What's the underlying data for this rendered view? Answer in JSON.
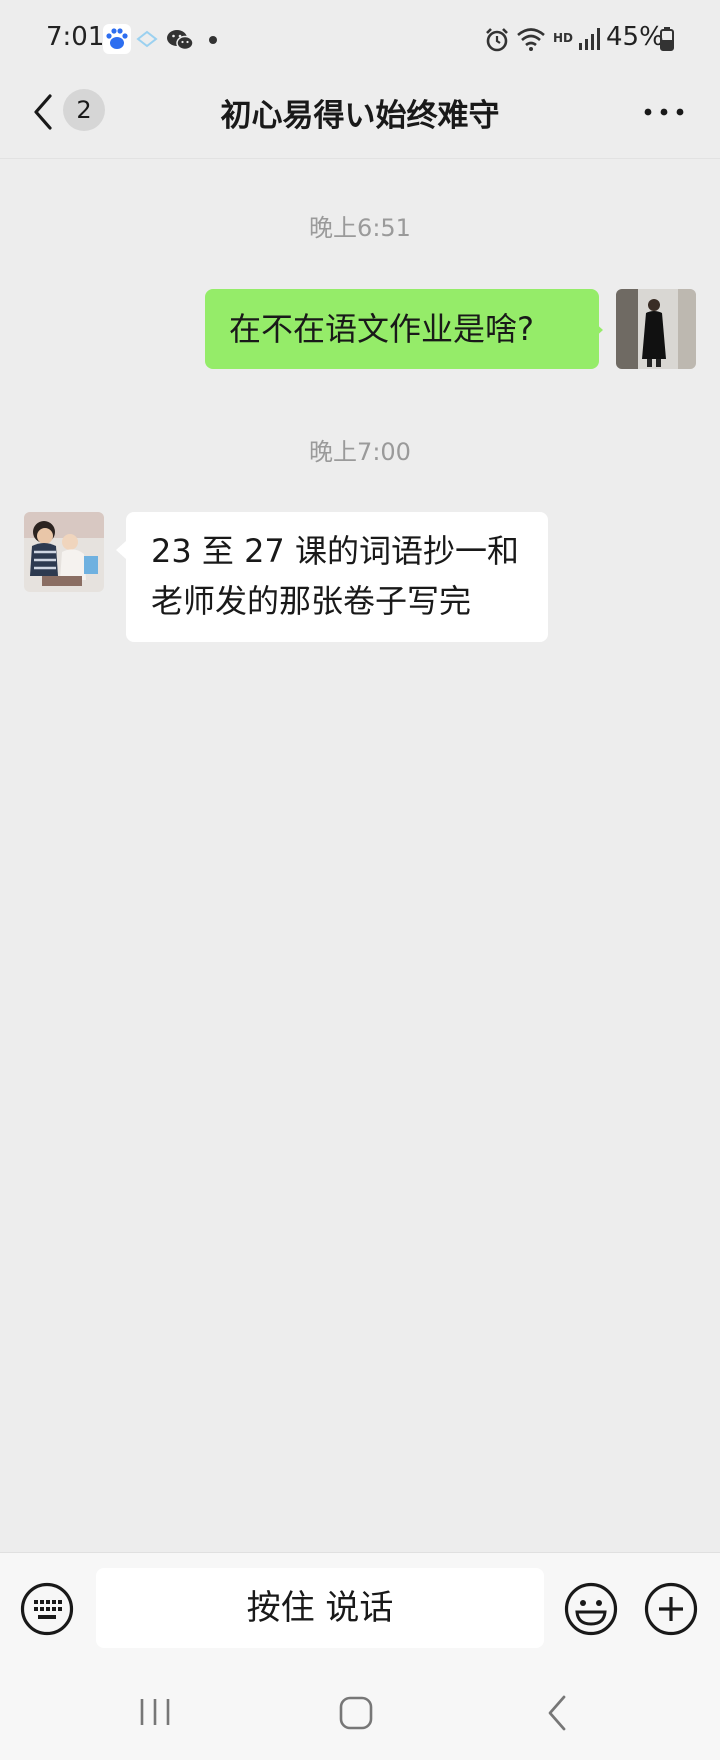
{
  "status_bar": {
    "time": "7:01",
    "battery": "45%",
    "icons": [
      "baidu-app-icon",
      "network-icon",
      "wechat-icon",
      "dot-icon",
      "alarm-icon",
      "wifi-icon",
      "hd-icon",
      "signal-icon",
      "battery-icon"
    ],
    "hd_label": "HD"
  },
  "header": {
    "unread_count": "2",
    "title": "初心易得い始终难守"
  },
  "messages": [
    {
      "timestamp": "晚上6:51",
      "direction": "out",
      "text": "在不在语文作业是啥?"
    },
    {
      "timestamp": "晚上7:00",
      "direction": "in",
      "text": "23 至 27 课的词语抄一和老师发的那张卷子写完"
    }
  ],
  "input_bar": {
    "hold_to_talk": "按住 说话"
  },
  "colors": {
    "background": "#ededed",
    "outgoing_bubble": "#95ec69",
    "incoming_bubble": "#ffffff",
    "timestamp": "#9a9a9a"
  }
}
